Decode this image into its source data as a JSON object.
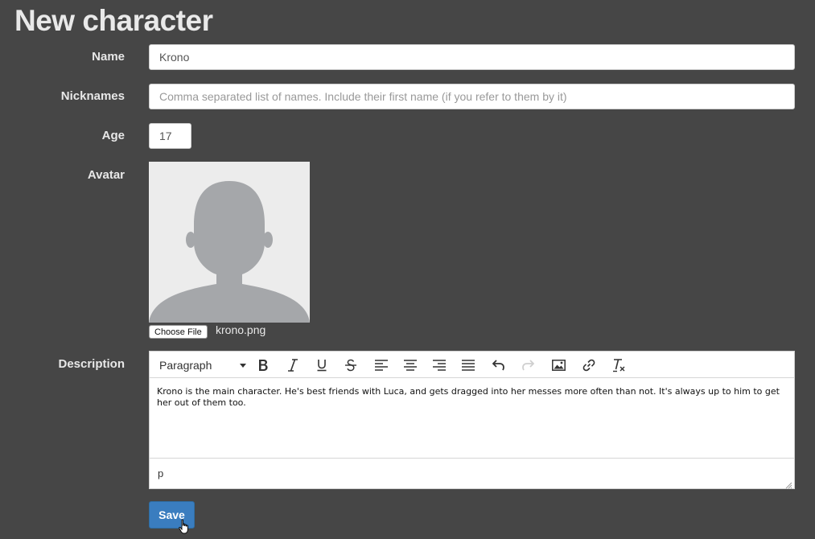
{
  "page": {
    "title": "New character"
  },
  "form": {
    "name": {
      "label": "Name",
      "value": "Krono"
    },
    "nicknames": {
      "label": "Nicknames",
      "placeholder": "Comma separated list of names. Include their first name (if you refer to them by it)"
    },
    "age": {
      "label": "Age",
      "value": "17"
    },
    "avatar": {
      "label": "Avatar",
      "choose_file_label": "Choose File",
      "file_name": "krono.png",
      "image_icon": "person-silhouette-icon"
    },
    "description": {
      "label": "Description",
      "format_value": "Paragraph",
      "toolbar_icons": [
        "bold-icon",
        "italic-icon",
        "underline-icon",
        "strikethrough-icon",
        "align-left-icon",
        "align-center-icon",
        "align-right-icon",
        "justify-icon",
        "undo-icon",
        "redo-icon",
        "image-icon",
        "link-icon",
        "clear-formatting-icon"
      ],
      "content": "Krono is the main character. He's best friends with Luca, and gets dragged into her messes more often than not. It's always up to him to get her out of them too.",
      "status_path": "p"
    },
    "save_label": "Save"
  },
  "colors": {
    "background": "#464646",
    "primary_button": "#3a7dbf",
    "label_text": "#e8e8e8"
  }
}
